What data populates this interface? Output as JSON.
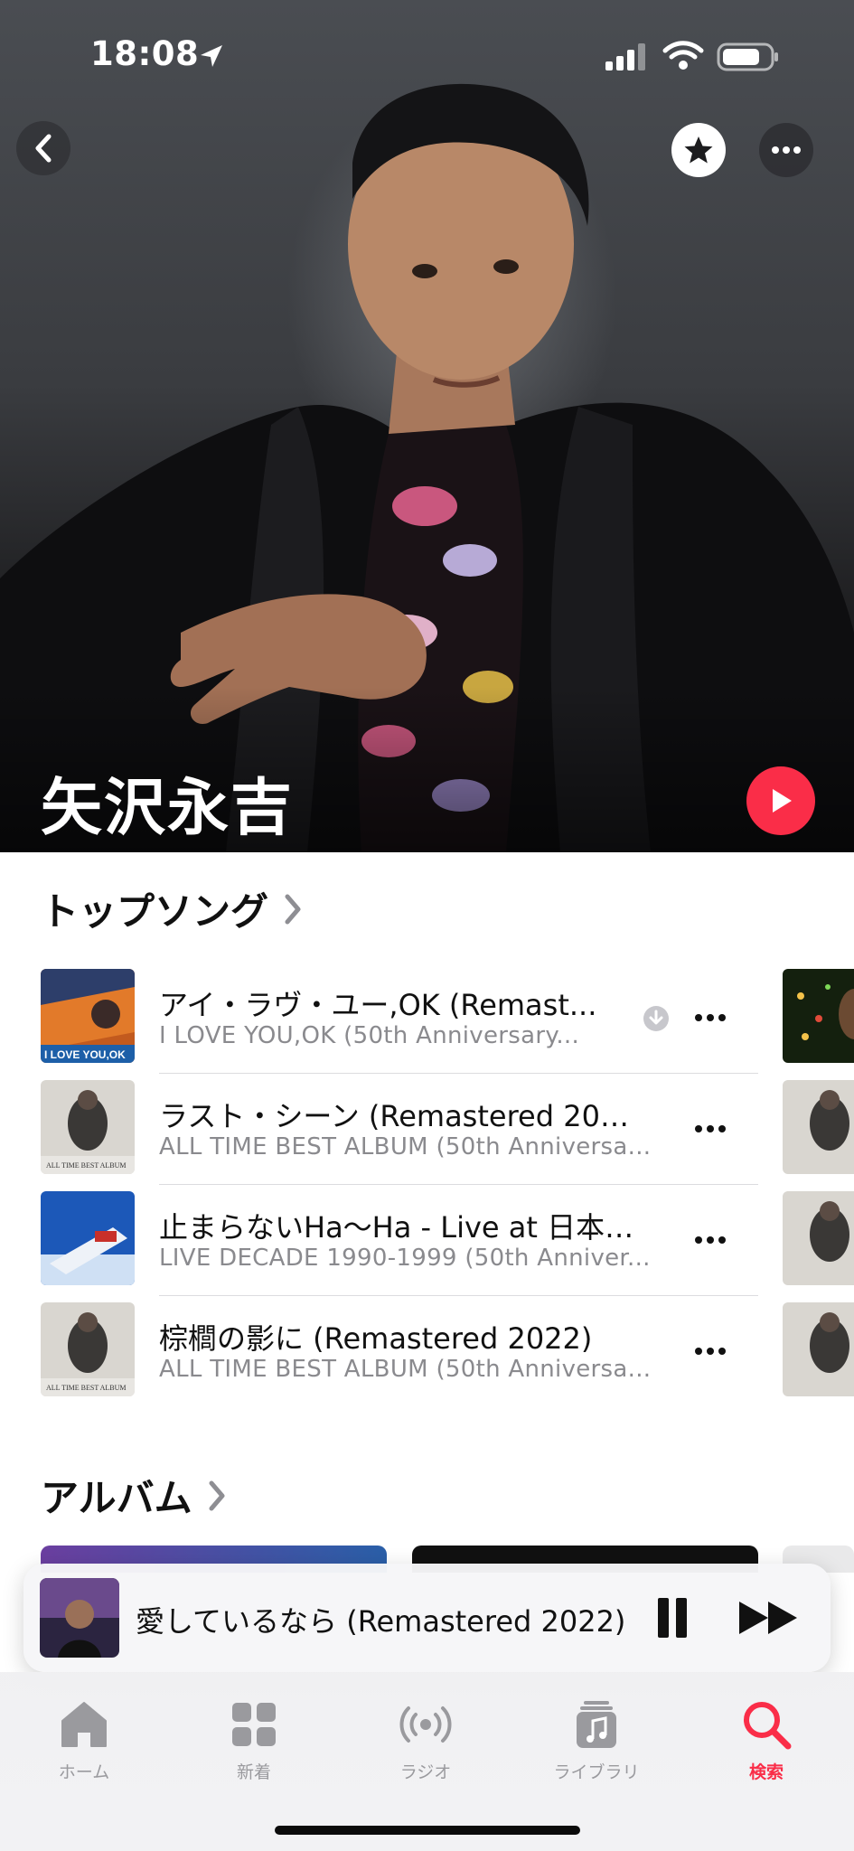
{
  "status_bar": {
    "time": "18:08"
  },
  "artist": {
    "name": "矢沢永吉"
  },
  "top_songs": {
    "title": "トップソング",
    "items": [
      {
        "title": "アイ・ラヴ・ユー,OK (Remast...",
        "subtitle": "I LOVE YOU,OK (50th Anniversary...",
        "downloaded": true
      },
      {
        "title": "ラスト・シーン (Remastered 2022)",
        "subtitle": "ALL TIME BEST ALBUM (50th Anniversa..."
      },
      {
        "title": "止まらないHa～Ha - Live at 日本…",
        "subtitle": "LIVE DECADE 1990-1999 (50th Anniver..."
      },
      {
        "title": "棕櫚の影に (Remastered 2022)",
        "subtitle": "ALL TIME BEST ALBUM (50th Anniversa..."
      }
    ]
  },
  "albums": {
    "title": "アルバム"
  },
  "now_playing": {
    "title": "愛しているなら (Remastered 2022)",
    "state": "playing"
  },
  "tab_bar": {
    "items": [
      {
        "label": "ホーム",
        "icon": "house-icon"
      },
      {
        "label": "新着",
        "icon": "grid-icon"
      },
      {
        "label": "ラジオ",
        "icon": "radio-waves-icon"
      },
      {
        "label": "ライブラリ",
        "icon": "music-library-icon"
      },
      {
        "label": "検索",
        "icon": "search-icon",
        "active": true
      }
    ]
  },
  "colors": {
    "accent": "#fa2d48",
    "secondary_text": "#8a8a8e"
  }
}
